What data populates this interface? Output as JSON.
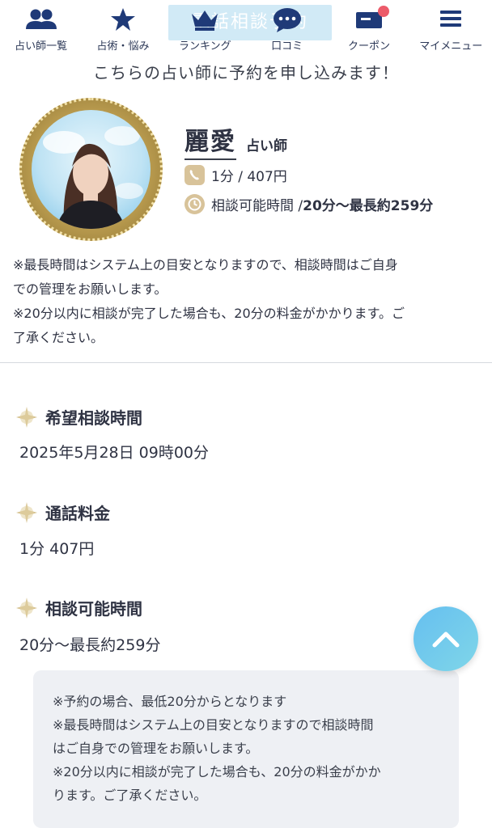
{
  "nav": {
    "banner_text": "電話相談予約",
    "items": [
      {
        "label": "占い師一覧",
        "icon": "users-icon"
      },
      {
        "label": "占術・悩み",
        "icon": "star-icon"
      },
      {
        "label": "ランキング",
        "icon": "crown-icon"
      },
      {
        "label": "口コミ",
        "icon": "chat-bubble-icon"
      },
      {
        "label": "クーポン",
        "icon": "ticket-icon"
      },
      {
        "label": "マイメニュー",
        "icon": "hamburger-menu-icon"
      }
    ]
  },
  "page_title": "こちらの占い師に予約を申し込みます！",
  "profile": {
    "name": "麗愛",
    "role": "占い師",
    "price": "1分 / 407円",
    "time_label": "相談可能時間 / ",
    "time_value": "20分〜最長約259分"
  },
  "note_lines": [
    "※最長時間はシステム上の目安となりますので、相談時間はご自身",
    "での管理をお願いします。",
    "※20分以内に相談が完了した場合も、20分の料金がかかります。ご",
    "了承ください。"
  ],
  "sections": {
    "datetime": {
      "heading": "希望相談時間",
      "value": "2025年5月28日 09時00分"
    },
    "fee": {
      "heading": "通話料金",
      "value": "1分 407円"
    },
    "duration": {
      "heading": "相談可能時間",
      "value": "20分〜最長約259分"
    }
  },
  "notice_lines": [
    "※予約の場合、最低20分からとなります",
    "※最長時間はシステム上の目安となりますので相談時間",
    "はご自身での管理をお願いします。",
    "※20分以内に相談が完了した場合も、20分の料金がかか",
    "ります。ご了承ください。"
  ],
  "colors": {
    "accent_gold": "#d8c39a",
    "nav_text": "#2b3756",
    "scroll_button": "#66bff0",
    "badge": "#ec5b6a"
  }
}
